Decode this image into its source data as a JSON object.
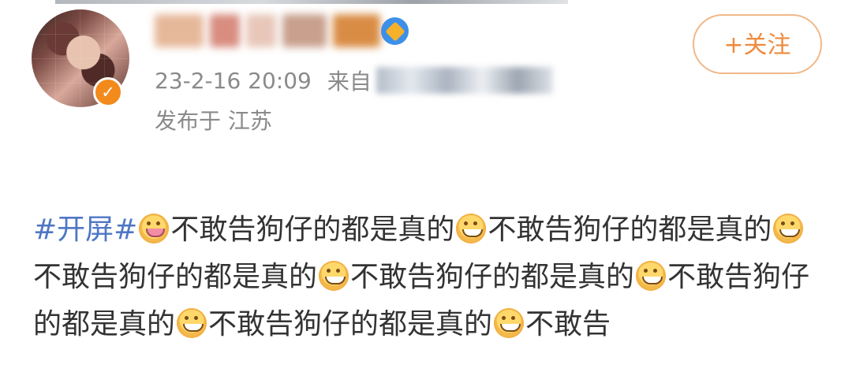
{
  "post": {
    "timestamp": "23-2-16 20:09",
    "source_prefix": "来自",
    "location": "发布于 江苏",
    "follow_button": "+关注",
    "hashtag": "#开屏#",
    "segments": [
      "不敢告狗仔的都是真的",
      "不敢告狗仔的都是真的",
      "不敢告狗仔的都是真的",
      "不敢告狗仔的都是真的",
      "不敢告狗仔的都是真的",
      "不敢告狗仔的都是真的",
      "不敢告"
    ]
  },
  "icons": {
    "avatar": "avatar-image",
    "avatar_badge": "verified-badge-icon",
    "user_verified": "blue-diamond-icon",
    "emoji_first": "blushing-face-icon",
    "emoji_repeat": "grinning-face-icon"
  },
  "colors": {
    "link": "#4f77c4",
    "follow": "#ef8a3d",
    "meta": "#8a8a8a",
    "text": "#333333"
  }
}
